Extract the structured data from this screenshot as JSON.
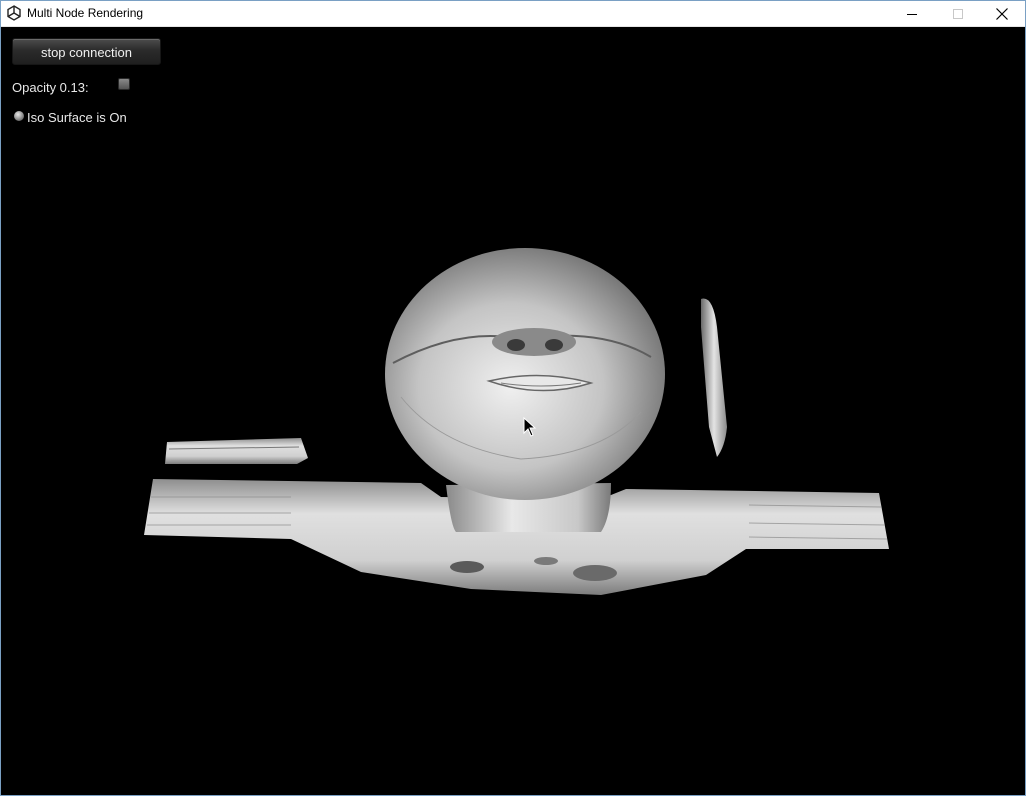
{
  "window": {
    "title": "Multi Node Rendering"
  },
  "controls": {
    "stop_button_label": "stop connection",
    "opacity_label": "Opacity 0.13:",
    "opacity_value": 0.13,
    "iso_surface_label": "Iso Surface is On",
    "iso_surface_on": true
  },
  "icons": {
    "app": "unity-icon",
    "minimize": "minimize-icon",
    "maximize": "maximize-icon",
    "close": "close-icon",
    "cursor": "mouse-cursor-icon"
  },
  "colors": {
    "viewport_background": "#000000",
    "surface": "#c9c9c9"
  }
}
